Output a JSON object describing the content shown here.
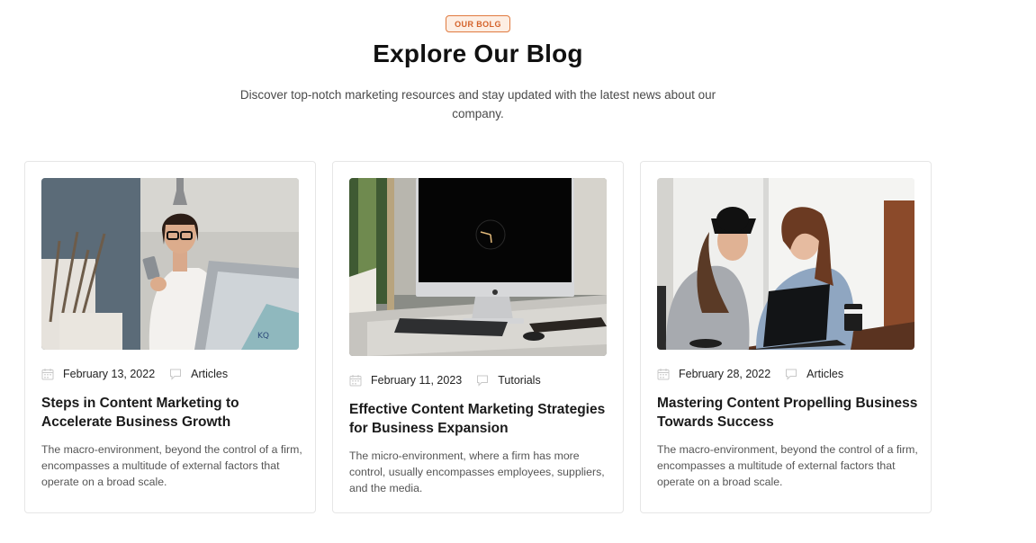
{
  "header": {
    "badge": "OUR BOLG",
    "title": "Explore Our Blog",
    "subtitle": "Discover top-notch marketing resources and stay updated with the latest news about our company."
  },
  "posts": [
    {
      "date": "February 13, 2022",
      "category": "Articles",
      "title": "Steps in Content Marketing to Accelerate Business Growth",
      "excerpt": "The macro-environment, beyond the control of a firm, encompasses a multitude of external factors that operate on a broad scale.",
      "image_icon": "woman-with-phone-photo"
    },
    {
      "date": "February 11, 2023",
      "category": "Tutorials",
      "title": "Effective Content Marketing Strategies for Business Expansion",
      "excerpt": "The micro-environment, where a firm has more control, usually encompasses employees, suppliers, and the media.",
      "image_icon": "desktop-computer-photo"
    },
    {
      "date": "February 28, 2022",
      "category": "Articles",
      "title": "Mastering Content Propelling Business Towards Success",
      "excerpt": "The macro-environment, beyond the control of a firm, encompasses a multitude of external factors that operate on a broad scale.",
      "image_icon": "two-women-laptop-photo"
    }
  ],
  "colors": {
    "accent": "#e07a3f",
    "badge_bg": "#fdeee3",
    "card_border": "#e6e6e6",
    "icon": "#c8c8c8"
  }
}
